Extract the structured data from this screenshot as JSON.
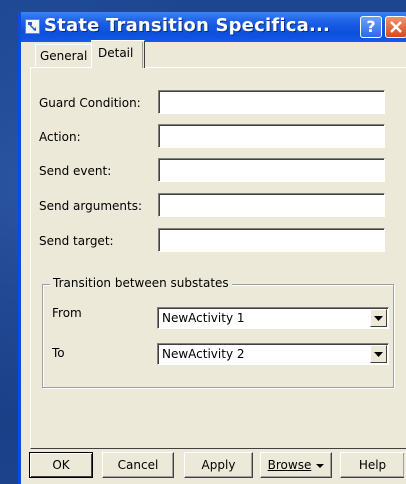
{
  "window": {
    "title": "State Transition Specifica...",
    "help_glyph": "?"
  },
  "tabs": [
    {
      "label": "General",
      "active": false
    },
    {
      "label": "Detail",
      "active": true
    }
  ],
  "fields": [
    {
      "label": "Guard Condition:",
      "value": ""
    },
    {
      "label": "Action:",
      "value": ""
    },
    {
      "label": "Send event:",
      "value": ""
    },
    {
      "label": "Send arguments:",
      "value": ""
    },
    {
      "label": "Send target:",
      "value": ""
    }
  ],
  "group": {
    "legend": "Transition between substates",
    "from": {
      "label": "From",
      "value": "NewActivity 1"
    },
    "to": {
      "label": "To",
      "value": "NewActivity 2"
    }
  },
  "buttons": {
    "ok": "OK",
    "cancel": "Cancel",
    "apply": "Apply",
    "browse": "Browse",
    "help": "Help"
  },
  "icons": [
    "app-icon",
    "help-icon",
    "close-icon",
    "chevron-down-icon"
  ],
  "colors": {
    "titlebar": "#0c4fdc",
    "close_button": "#d8481e",
    "dialog_face": "#ece9d8",
    "desktop": "#1a3f86"
  }
}
